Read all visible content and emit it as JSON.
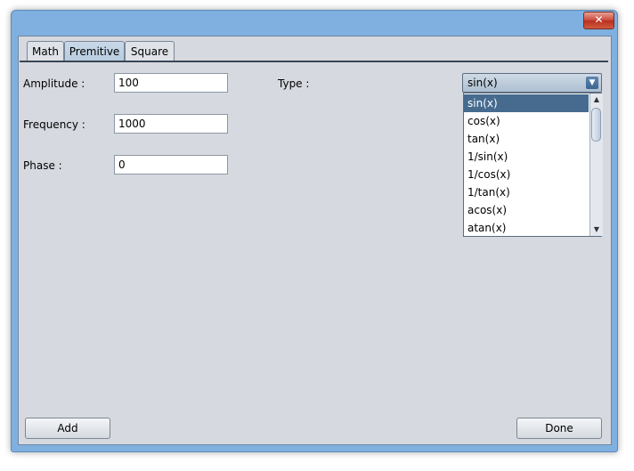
{
  "window": {
    "close_label": "✕"
  },
  "tabs": [
    {
      "label": "Math"
    },
    {
      "label": "Premitive"
    },
    {
      "label": "Square"
    }
  ],
  "form": {
    "amplitude_label": "Amplitude :",
    "amplitude_value": "100",
    "frequency_label": "Frequency :",
    "frequency_value": "1000",
    "phase_label": "Phase :",
    "phase_value": "0",
    "type_label": "Type :"
  },
  "type_select": {
    "selected": "sin(x)",
    "arrow": "▼",
    "options": [
      "sin(x)",
      "cos(x)",
      "tan(x)",
      "1/sin(x)",
      "1/cos(x)",
      "1/tan(x)",
      "acos(x)",
      "atan(x)"
    ],
    "scroll_up": "▲",
    "scroll_down": "▼"
  },
  "buttons": {
    "add": "Add",
    "done": "Done"
  }
}
